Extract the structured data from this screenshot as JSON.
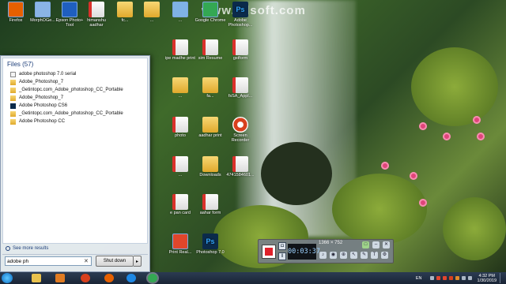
{
  "wallpaper": {
    "watermark": "www.zdsoft.com"
  },
  "desktop_icons": [
    {
      "id": "firefox",
      "label": "Firefox",
      "kind": "app",
      "color": "#e66000"
    },
    {
      "id": "morpho",
      "label": "MorphOGe...",
      "kind": "app",
      "color": "#8ab4e6"
    },
    {
      "id": "epson",
      "label": "Epson Photo+ Tool",
      "kind": "app",
      "color": "#1f5fbf"
    },
    {
      "id": "himanshu",
      "label": "himanshu aadhar",
      "kind": "pdf"
    },
    {
      "id": "fc1",
      "label": "fc...",
      "kind": "folder"
    },
    {
      "id": "fc2",
      "label": "...",
      "kind": "folder"
    },
    {
      "id": "e1",
      "label": "...",
      "kind": "app",
      "color": "#7fb2e5"
    },
    {
      "id": "google",
      "label": "Google Chrome",
      "kind": "app",
      "color": "#34a853"
    },
    {
      "id": "photoshop1",
      "label": "Adobe Photoshop...",
      "kind": "ps"
    },
    {
      "id": "ipe",
      "label": "ipe madhe print",
      "kind": "pdf"
    },
    {
      "id": "sim",
      "label": "sim Resume",
      "kind": "pdf"
    },
    {
      "id": "gstform",
      "label": "gstform",
      "kind": "pdf"
    },
    {
      "id": "ihdf",
      "label": "...",
      "kind": "folder"
    },
    {
      "id": "fa",
      "label": "fa...",
      "kind": "folder"
    },
    {
      "id": "fsa",
      "label": "fsSA_Appl...",
      "kind": "pdf"
    },
    {
      "id": "photo",
      "label": "photo",
      "kind": "pdf"
    },
    {
      "id": "aadhar_print",
      "label": "aadhar print",
      "kind": "folder"
    },
    {
      "id": "screen_rec",
      "label": "Screen Recorder",
      "kind": "rec"
    },
    {
      "id": "rd",
      "label": "...",
      "kind": "pdf"
    },
    {
      "id": "downloads",
      "label": "Downloads",
      "kind": "folder"
    },
    {
      "id": "num",
      "label": "4741584601...",
      "kind": "pdf"
    },
    {
      "id": "epan",
      "label": "e pan card",
      "kind": "pdf"
    },
    {
      "id": "aahar",
      "label": "aahar form",
      "kind": "pdf"
    },
    {
      "id": "print_real",
      "label": "Print Real...",
      "kind": "app",
      "color": "#e0462b"
    },
    {
      "id": "photoshop2",
      "label": "Photoshop 7.0",
      "kind": "ps"
    }
  ],
  "start_menu": {
    "header": "Files (57)",
    "results": [
      {
        "label": "adobe photoshop 7.0 serial",
        "icon": "text"
      },
      {
        "label": "Adobe_Photoshop_7",
        "icon": "folder"
      },
      {
        "label": "_Getintopc.com_Adobe_photoshop_CC_Portable",
        "icon": "folder"
      },
      {
        "label": "Adobe_Photoshop_7",
        "icon": "folder"
      },
      {
        "label": "Adobe Photoshop CS6",
        "icon": "ps"
      },
      {
        "label": "_Getintopc.com_Adobe_photoshop_CC_Portable",
        "icon": "folder"
      },
      {
        "label": "Adobe Photoshop CC",
        "icon": "folder"
      }
    ],
    "see_more": "See more results",
    "search_value": "adobe ph",
    "shutdown_label": "Shut down"
  },
  "recorder": {
    "timer": "00:03:37",
    "size_readout": "1366 × 752"
  },
  "taskbar": {
    "language": "EN",
    "time": "4:32 PM",
    "date": "1/30/2019"
  },
  "colors": {
    "taskbar": "#1a2535",
    "start_menu_bg": "#e9eef5",
    "record_red": "#e0212a"
  }
}
